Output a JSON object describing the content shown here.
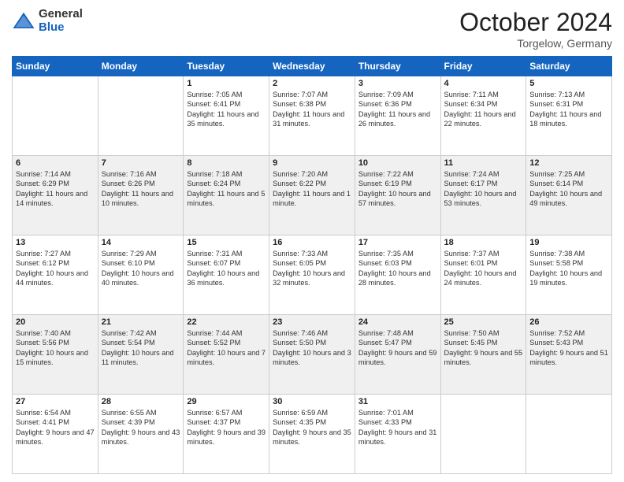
{
  "header": {
    "logo_general": "General",
    "logo_blue": "Blue",
    "month_title": "October 2024",
    "location": "Torgelow, Germany"
  },
  "days_of_week": [
    "Sunday",
    "Monday",
    "Tuesday",
    "Wednesday",
    "Thursday",
    "Friday",
    "Saturday"
  ],
  "weeks": [
    [
      {
        "day": "",
        "sunrise": "",
        "sunset": "",
        "daylight": ""
      },
      {
        "day": "",
        "sunrise": "",
        "sunset": "",
        "daylight": ""
      },
      {
        "day": "1",
        "sunrise": "Sunrise: 7:05 AM",
        "sunset": "Sunset: 6:41 PM",
        "daylight": "Daylight: 11 hours and 35 minutes."
      },
      {
        "day": "2",
        "sunrise": "Sunrise: 7:07 AM",
        "sunset": "Sunset: 6:38 PM",
        "daylight": "Daylight: 11 hours and 31 minutes."
      },
      {
        "day": "3",
        "sunrise": "Sunrise: 7:09 AM",
        "sunset": "Sunset: 6:36 PM",
        "daylight": "Daylight: 11 hours and 26 minutes."
      },
      {
        "day": "4",
        "sunrise": "Sunrise: 7:11 AM",
        "sunset": "Sunset: 6:34 PM",
        "daylight": "Daylight: 11 hours and 22 minutes."
      },
      {
        "day": "5",
        "sunrise": "Sunrise: 7:13 AM",
        "sunset": "Sunset: 6:31 PM",
        "daylight": "Daylight: 11 hours and 18 minutes."
      }
    ],
    [
      {
        "day": "6",
        "sunrise": "Sunrise: 7:14 AM",
        "sunset": "Sunset: 6:29 PM",
        "daylight": "Daylight: 11 hours and 14 minutes."
      },
      {
        "day": "7",
        "sunrise": "Sunrise: 7:16 AM",
        "sunset": "Sunset: 6:26 PM",
        "daylight": "Daylight: 11 hours and 10 minutes."
      },
      {
        "day": "8",
        "sunrise": "Sunrise: 7:18 AM",
        "sunset": "Sunset: 6:24 PM",
        "daylight": "Daylight: 11 hours and 5 minutes."
      },
      {
        "day": "9",
        "sunrise": "Sunrise: 7:20 AM",
        "sunset": "Sunset: 6:22 PM",
        "daylight": "Daylight: 11 hours and 1 minute."
      },
      {
        "day": "10",
        "sunrise": "Sunrise: 7:22 AM",
        "sunset": "Sunset: 6:19 PM",
        "daylight": "Daylight: 10 hours and 57 minutes."
      },
      {
        "day": "11",
        "sunrise": "Sunrise: 7:24 AM",
        "sunset": "Sunset: 6:17 PM",
        "daylight": "Daylight: 10 hours and 53 minutes."
      },
      {
        "day": "12",
        "sunrise": "Sunrise: 7:25 AM",
        "sunset": "Sunset: 6:14 PM",
        "daylight": "Daylight: 10 hours and 49 minutes."
      }
    ],
    [
      {
        "day": "13",
        "sunrise": "Sunrise: 7:27 AM",
        "sunset": "Sunset: 6:12 PM",
        "daylight": "Daylight: 10 hours and 44 minutes."
      },
      {
        "day": "14",
        "sunrise": "Sunrise: 7:29 AM",
        "sunset": "Sunset: 6:10 PM",
        "daylight": "Daylight: 10 hours and 40 minutes."
      },
      {
        "day": "15",
        "sunrise": "Sunrise: 7:31 AM",
        "sunset": "Sunset: 6:07 PM",
        "daylight": "Daylight: 10 hours and 36 minutes."
      },
      {
        "day": "16",
        "sunrise": "Sunrise: 7:33 AM",
        "sunset": "Sunset: 6:05 PM",
        "daylight": "Daylight: 10 hours and 32 minutes."
      },
      {
        "day": "17",
        "sunrise": "Sunrise: 7:35 AM",
        "sunset": "Sunset: 6:03 PM",
        "daylight": "Daylight: 10 hours and 28 minutes."
      },
      {
        "day": "18",
        "sunrise": "Sunrise: 7:37 AM",
        "sunset": "Sunset: 6:01 PM",
        "daylight": "Daylight: 10 hours and 24 minutes."
      },
      {
        "day": "19",
        "sunrise": "Sunrise: 7:38 AM",
        "sunset": "Sunset: 5:58 PM",
        "daylight": "Daylight: 10 hours and 19 minutes."
      }
    ],
    [
      {
        "day": "20",
        "sunrise": "Sunrise: 7:40 AM",
        "sunset": "Sunset: 5:56 PM",
        "daylight": "Daylight: 10 hours and 15 minutes."
      },
      {
        "day": "21",
        "sunrise": "Sunrise: 7:42 AM",
        "sunset": "Sunset: 5:54 PM",
        "daylight": "Daylight: 10 hours and 11 minutes."
      },
      {
        "day": "22",
        "sunrise": "Sunrise: 7:44 AM",
        "sunset": "Sunset: 5:52 PM",
        "daylight": "Daylight: 10 hours and 7 minutes."
      },
      {
        "day": "23",
        "sunrise": "Sunrise: 7:46 AM",
        "sunset": "Sunset: 5:50 PM",
        "daylight": "Daylight: 10 hours and 3 minutes."
      },
      {
        "day": "24",
        "sunrise": "Sunrise: 7:48 AM",
        "sunset": "Sunset: 5:47 PM",
        "daylight": "Daylight: 9 hours and 59 minutes."
      },
      {
        "day": "25",
        "sunrise": "Sunrise: 7:50 AM",
        "sunset": "Sunset: 5:45 PM",
        "daylight": "Daylight: 9 hours and 55 minutes."
      },
      {
        "day": "26",
        "sunrise": "Sunrise: 7:52 AM",
        "sunset": "Sunset: 5:43 PM",
        "daylight": "Daylight: 9 hours and 51 minutes."
      }
    ],
    [
      {
        "day": "27",
        "sunrise": "Sunrise: 6:54 AM",
        "sunset": "Sunset: 4:41 PM",
        "daylight": "Daylight: 9 hours and 47 minutes."
      },
      {
        "day": "28",
        "sunrise": "Sunrise: 6:55 AM",
        "sunset": "Sunset: 4:39 PM",
        "daylight": "Daylight: 9 hours and 43 minutes."
      },
      {
        "day": "29",
        "sunrise": "Sunrise: 6:57 AM",
        "sunset": "Sunset: 4:37 PM",
        "daylight": "Daylight: 9 hours and 39 minutes."
      },
      {
        "day": "30",
        "sunrise": "Sunrise: 6:59 AM",
        "sunset": "Sunset: 4:35 PM",
        "daylight": "Daylight: 9 hours and 35 minutes."
      },
      {
        "day": "31",
        "sunrise": "Sunrise: 7:01 AM",
        "sunset": "Sunset: 4:33 PM",
        "daylight": "Daylight: 9 hours and 31 minutes."
      },
      {
        "day": "",
        "sunrise": "",
        "sunset": "",
        "daylight": ""
      },
      {
        "day": "",
        "sunrise": "",
        "sunset": "",
        "daylight": ""
      }
    ]
  ]
}
